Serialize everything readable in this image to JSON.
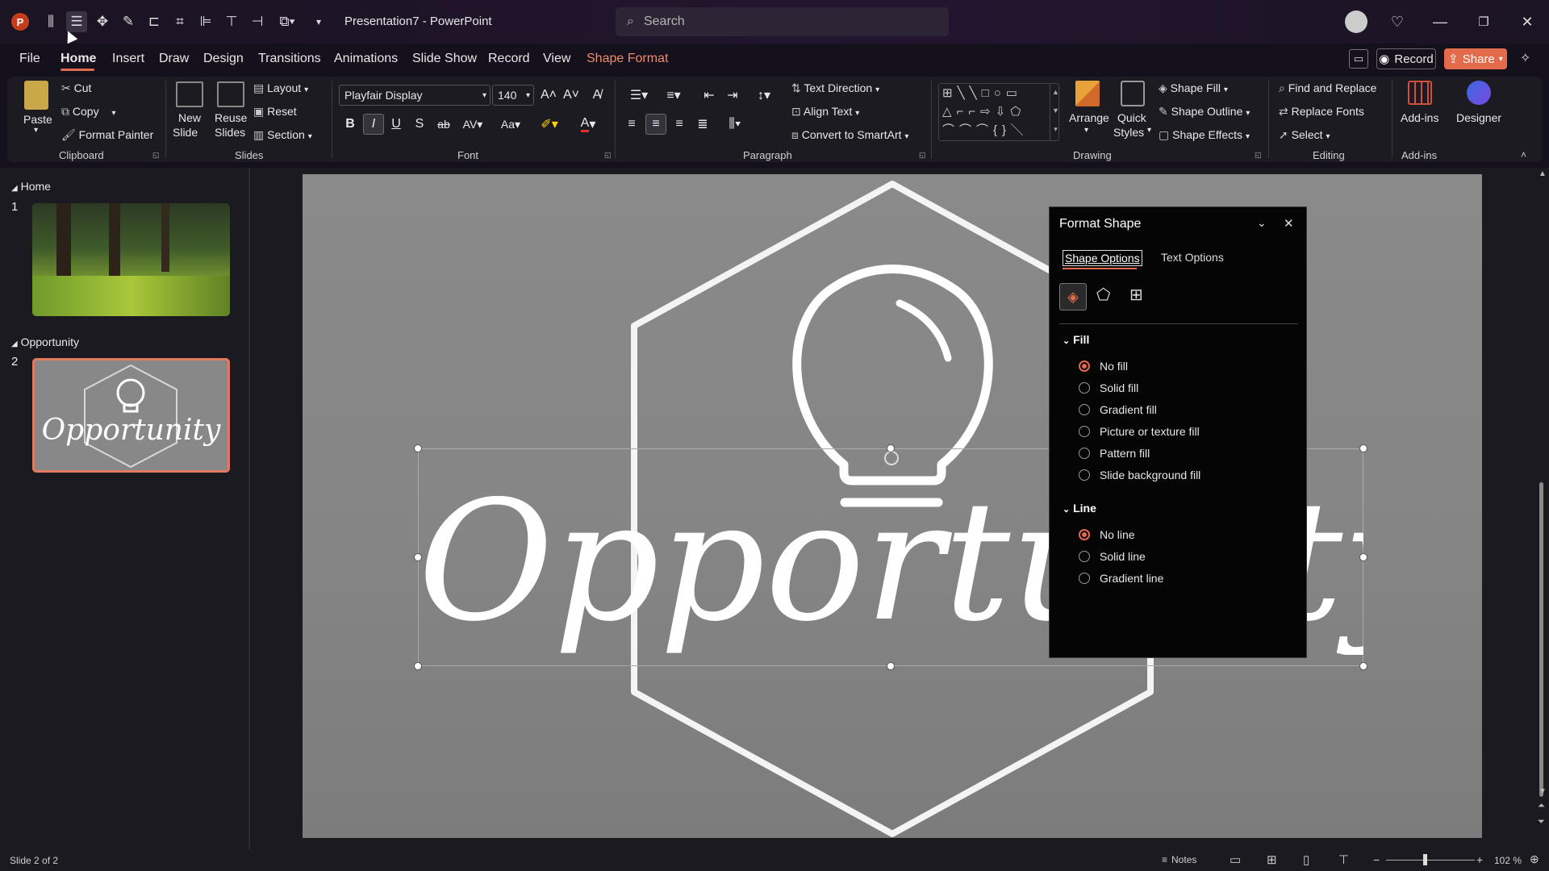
{
  "window": {
    "app_title": "Presentation7 - PowerPoint"
  },
  "search": {
    "placeholder": "Search"
  },
  "tabs": [
    {
      "label": "File"
    },
    {
      "label": "Home"
    },
    {
      "label": "Insert"
    },
    {
      "label": "Draw"
    },
    {
      "label": "Design"
    },
    {
      "label": "Transitions"
    },
    {
      "label": "Animations"
    },
    {
      "label": "Slide Show"
    },
    {
      "label": "Record"
    },
    {
      "label": "View"
    },
    {
      "label": "Shape Format"
    }
  ],
  "top_right": {
    "record_label": "Record",
    "share_label": "Share"
  },
  "ribbon": {
    "clipboard": {
      "paste": "Paste",
      "cut": "Cut",
      "copy": "Copy",
      "format_painter": "Format Painter",
      "group": "Clipboard"
    },
    "slides": {
      "new_slide_1": "New",
      "new_slide_2": "Slide",
      "reuse_1": "Reuse",
      "reuse_2": "Slides",
      "layout": "Layout",
      "reset": "Reset",
      "section": "Section",
      "group": "Slides"
    },
    "font": {
      "family": "Playfair Display",
      "size": "140",
      "group": "Font"
    },
    "paragraph": {
      "text_direction": "Text Direction",
      "align_text": "Align Text",
      "convert_smartart": "Convert to SmartArt",
      "group": "Paragraph"
    },
    "drawing": {
      "arrange": "Arrange",
      "quick_1": "Quick",
      "quick_2": "Styles",
      "shape_fill": "Shape Fill",
      "shape_outline": "Shape Outline",
      "shape_effects": "Shape Effects",
      "group": "Drawing"
    },
    "editing": {
      "find_replace": "Find and Replace",
      "replace_fonts": "Replace Fonts",
      "select": "Select",
      "group": "Editing"
    },
    "addins": {
      "addins": "Add-ins",
      "designer": "Designer",
      "group": "Add-ins"
    }
  },
  "slides_pane": {
    "sections": [
      {
        "name": "Home"
      },
      {
        "name": "Opportunity"
      }
    ],
    "slides": [
      {
        "number": "1"
      },
      {
        "number": "2",
        "title": "Opportunity"
      }
    ]
  },
  "slide": {
    "title_text": "Opportunity"
  },
  "format_pane": {
    "title": "Format Shape",
    "tabs": [
      "Shape Options",
      "Text Options"
    ],
    "fill_header": "Fill",
    "fill_options": [
      "No fill",
      "Solid fill",
      "Gradient fill",
      "Picture or texture fill",
      "Pattern fill",
      "Slide background fill"
    ],
    "fill_selected": "No fill",
    "line_header": "Line",
    "line_options": [
      "No line",
      "Solid line",
      "Gradient line"
    ],
    "line_selected": "No line"
  },
  "status": {
    "slide_info": "Slide 2 of 2",
    "notes": "Notes",
    "zoom": "102 %"
  },
  "colors": {
    "accent": "#e36a4a",
    "share_bg": "#e36a4a"
  }
}
